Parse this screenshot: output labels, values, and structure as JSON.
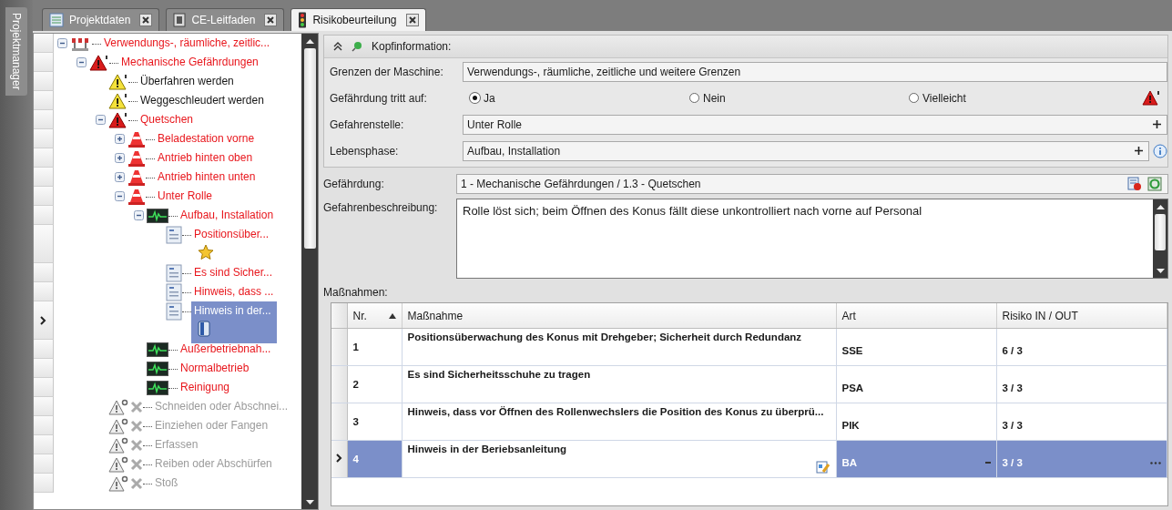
{
  "side_panel": {
    "title": "Projektmanager"
  },
  "tabs": [
    {
      "label": "Projektdaten",
      "kind": "sheet",
      "selected": false
    },
    {
      "label": "CE-Leitfaden",
      "kind": "book",
      "selected": false
    },
    {
      "label": "Risikobeurteilung",
      "kind": "traffic-light",
      "selected": true
    }
  ],
  "tree": {
    "items": [
      {
        "label": "Verwendungs-, räumliche, zeitlic...",
        "kind": "limits",
        "expanded": true,
        "selected": false,
        "children": [
          {
            "label": "Mechanische Gefährdungen",
            "kind": "hazard",
            "expanded": true,
            "selected": false,
            "children": [
              {
                "label": "Überfahren werden",
                "kind": "minor-hazard",
                "selected": false
              },
              {
                "label": "Weggeschleudert werden",
                "kind": "minor-hazard",
                "selected": false
              },
              {
                "label": "Quetschen",
                "kind": "hazard",
                "expanded": true,
                "selected": false,
                "children": [
                  {
                    "label": "Beladestation vorne",
                    "kind": "danger-point",
                    "expanded": false,
                    "selected": false
                  },
                  {
                    "label": "Antrieb hinten oben",
                    "kind": "danger-point",
                    "expanded": false,
                    "selected": false
                  },
                  {
                    "label": "Antrieb hinten unten",
                    "kind": "danger-point",
                    "expanded": false,
                    "selected": false
                  },
                  {
                    "label": "Unter Rolle",
                    "kind": "danger-point",
                    "expanded": true,
                    "selected": false,
                    "children": [
                      {
                        "label": "Aufbau, Installation",
                        "kind": "life-phase",
                        "expanded": true,
                        "selected": false,
                        "children": [
                          {
                            "label": "Positionsüber...",
                            "kind": "measure",
                            "starred": true,
                            "selected": false
                          },
                          {
                            "label": "Es sind Sicher...",
                            "kind": "measure",
                            "selected": false
                          },
                          {
                            "label": "Hinweis, dass ...",
                            "kind": "measure",
                            "selected": false
                          },
                          {
                            "label": "Hinweis in der...",
                            "kind": "measure",
                            "bookmarked": true,
                            "selected": true
                          }
                        ]
                      },
                      {
                        "label": "Außerbetriebnah...",
                        "kind": "life-phase",
                        "selected": false
                      },
                      {
                        "label": "Normalbetrieb",
                        "kind": "life-phase",
                        "selected": false
                      },
                      {
                        "label": "Reinigung",
                        "kind": "life-phase",
                        "selected": false
                      }
                    ]
                  }
                ]
              },
              {
                "label": "Schneiden oder Abschnei...",
                "kind": "inactive",
                "selected": false
              },
              {
                "label": "Einziehen oder Fangen",
                "kind": "inactive",
                "selected": false
              },
              {
                "label": "Erfassen",
                "kind": "inactive",
                "selected": false
              },
              {
                "label": "Reiben oder Abschürfen",
                "kind": "inactive",
                "selected": false
              },
              {
                "label": "Stoß",
                "kind": "inactive",
                "selected": false
              }
            ]
          }
        ]
      }
    ]
  },
  "header": {
    "title": "Kopfinformation:",
    "expanded": true
  },
  "form": {
    "machine_limits": {
      "label": "Grenzen der Maschine:",
      "value": "Verwendungs-, räumliche, zeitliche und weitere Grenzen"
    },
    "occurrence": {
      "label": "Gefährdung tritt auf:",
      "options": [
        {
          "label": "Ja",
          "selected": true
        },
        {
          "label": "Nein",
          "selected": false
        },
        {
          "label": "Vielleicht",
          "selected": false
        }
      ]
    },
    "danger_point": {
      "label": "Gefahrenstelle:",
      "value": "Unter Rolle"
    },
    "life_phase": {
      "label": "Lebensphase:",
      "value": "Aufbau, Installation"
    },
    "hazard": {
      "label": "Gefährdung:",
      "value": "1 - Mechanische Gefährdungen / 1.3 - Quetschen"
    },
    "description": {
      "label": "Gefahrenbeschreibung:",
      "value": "Rolle löst sich; beim Öffnen des Konus fällt diese unkontrolliert nach vorne auf Personal"
    }
  },
  "measures": {
    "label": "Maßnahmen:",
    "columns": [
      {
        "label": "Nr.",
        "sorted_ascending": true
      },
      {
        "label": "Maßnahme"
      },
      {
        "label": "Art"
      },
      {
        "label": "Risiko IN / OUT"
      }
    ],
    "rows": [
      {
        "nr": "1",
        "measure": "Positionsüberwachung des Konus mit Drehgeber; Sicherheit durch Redundanz",
        "type": "SSE",
        "risk": "6 / 3",
        "selected": false
      },
      {
        "nr": "2",
        "measure": "Es sind Sicherheitsschuhe zu tragen",
        "type": "PSA",
        "risk": "3 / 3",
        "selected": false
      },
      {
        "nr": "3",
        "measure": "Hinweis, dass vor Öffnen des Rollenwechslers die Position des Konus zu überprü...",
        "type": "PIK",
        "risk": "3 / 3",
        "selected": false
      },
      {
        "nr": "4",
        "measure": "Hinweis in der Beriebsanleitung",
        "type": "BA",
        "risk": "3 / 3",
        "selected": true
      }
    ]
  }
}
